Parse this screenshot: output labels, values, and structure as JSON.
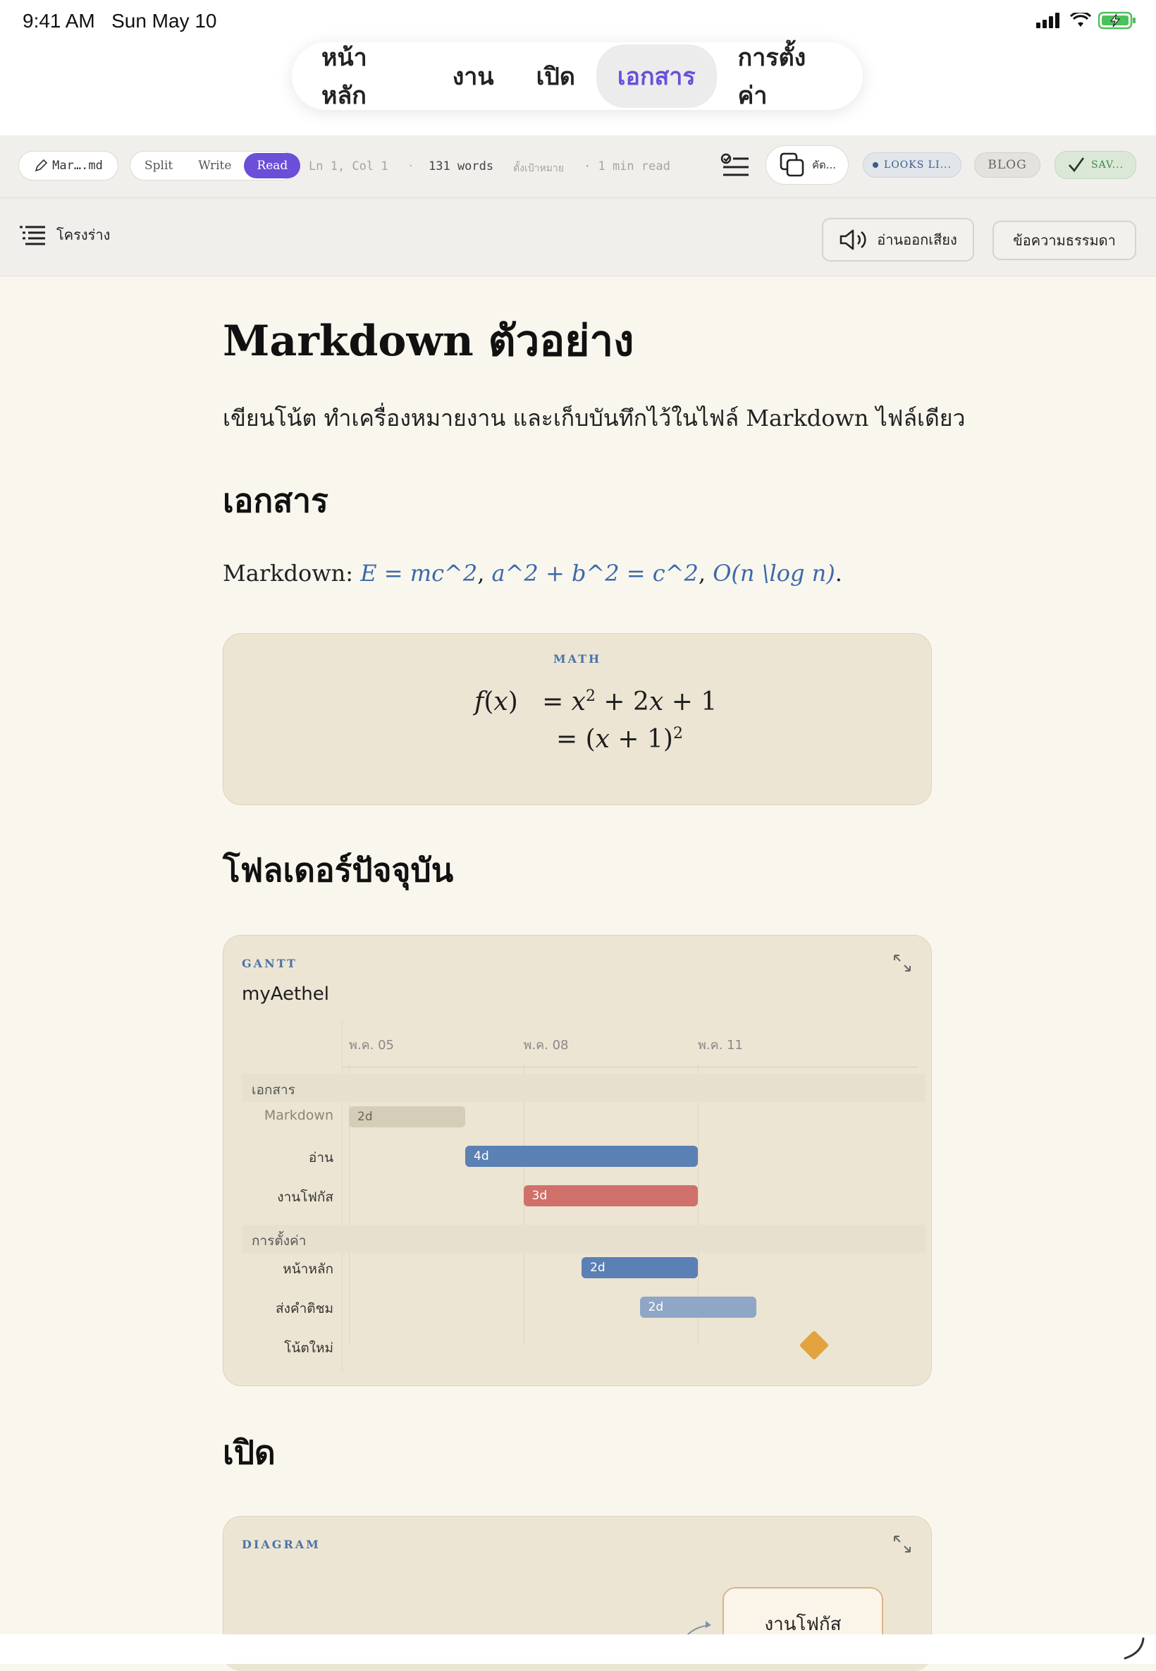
{
  "status": {
    "time": "9:41 AM",
    "date": "Sun May 10"
  },
  "nav": {
    "items": [
      {
        "label": "หน้าหลัก"
      },
      {
        "label": "งาน"
      },
      {
        "label": "เปิด"
      },
      {
        "label": "เอกสาร"
      },
      {
        "label": "การตั้งค่า"
      }
    ],
    "active_index": 3
  },
  "toolbar": {
    "file_name": "Mar….md",
    "modes": [
      "Split",
      "Write",
      "Read"
    ],
    "active_mode": "Read",
    "cursor": "Ln 1, Col 1",
    "separator": "·",
    "words": "131 words",
    "goal": "ตั้งเป้าหมาย",
    "read_time": "· 1 min read",
    "copy_label": "คัด...",
    "looks_label": "LOOKS LI...",
    "blog_label": "BLOG",
    "saved_label": "SAV..."
  },
  "subbar": {
    "outline_label": "โครงร่าง",
    "read_aloud_label": "อ่านออกเสียง",
    "plain_text_label": "ข้อความธรรมดา"
  },
  "document": {
    "title": "Markdown ตัวอย่าง",
    "intro": "เขียนโน้ต ทำเครื่องหมายงาน และเก็บบันทึกไว้ในไฟล์ Markdown ไฟล์เดียว",
    "h_docs": "เอกสาร",
    "md_prefix": "Markdown: ",
    "math_inline": [
      "E = mc^2",
      "a^2 + b^2 = c^2",
      "O(n \\log n)"
    ],
    "math_card_label": "MATH",
    "h_folder": "โฟลเดอร์ปัจจุบัน",
    "h_open": "เปิด",
    "diagram_label": "DIAGRAM",
    "diagram_node": "งานโฟกัส"
  },
  "gantt": {
    "label": "GANTT",
    "title": "myAethel",
    "ticks": [
      "พ.ค. 05",
      "พ.ค. 08",
      "พ.ค. 11"
    ],
    "sections": [
      {
        "name": "เอกสาร",
        "tasks": [
          {
            "name": "Markdown",
            "start": 0,
            "days": 2,
            "label": "2d",
            "color": "#d6cdb9",
            "text_color": "#6b6456",
            "muted": true
          },
          {
            "name": "อ่าน",
            "start": 2,
            "days": 4,
            "label": "4d",
            "color": "#5b80b4",
            "text_color": "#ffffff"
          },
          {
            "name": "งานโฟกัส",
            "start": 3,
            "days": 3,
            "label": "3d",
            "color": "#d0706a",
            "text_color": "#ffffff"
          }
        ]
      },
      {
        "name": "การตั้งค่า",
        "tasks": [
          {
            "name": "หน้าหลัก",
            "start": 4,
            "days": 2,
            "label": "2d",
            "color": "#5b80b4",
            "text_color": "#ffffff"
          },
          {
            "name": "ส่งคำติชม",
            "start": 5,
            "days": 2,
            "label": "2d",
            "color": "#8fa6c6",
            "text_color": "#ffffff"
          },
          {
            "name": "โน้ตใหม่",
            "start": 7,
            "milestone": true,
            "color": "#e2a23e"
          }
        ]
      }
    ]
  },
  "colors": {
    "accent": "#6b4fd8",
    "link": "#3a6aa8",
    "saved": "#3c8a4a"
  }
}
